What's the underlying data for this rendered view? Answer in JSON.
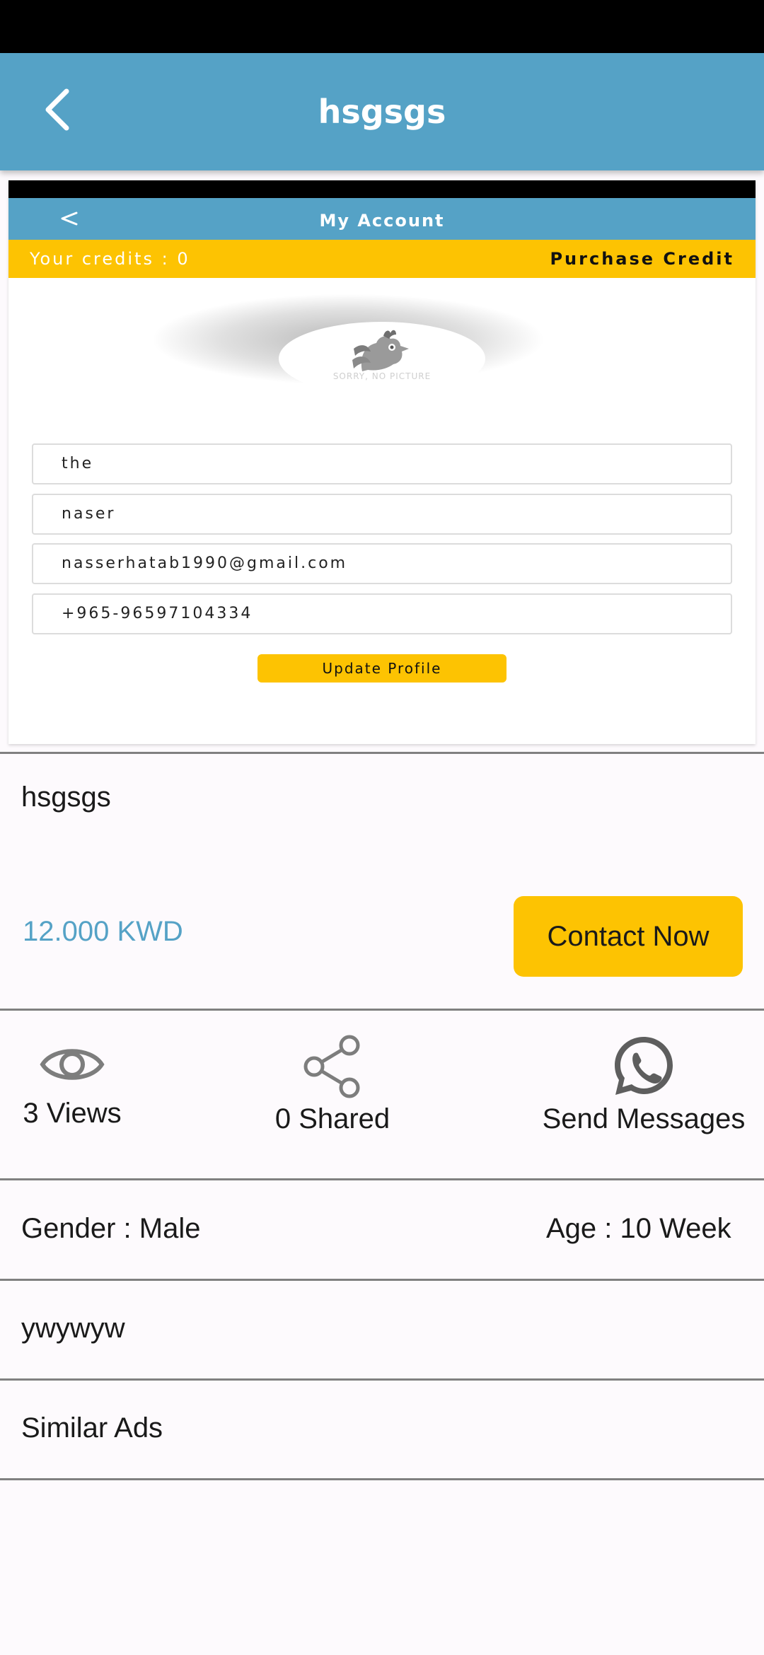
{
  "app_bar": {
    "title": "hsgsgs",
    "back_icon": "chevron-left-icon"
  },
  "ad_image": {
    "header_title": "My Account",
    "credits_text": "Your credits : 0",
    "purchase_text": "Purchase Credit",
    "no_picture_text": "SORRY, NO PICTURE",
    "fields": [
      "the",
      "naser",
      "nasserhatab1990@gmail.com",
      "+965-96597104334"
    ],
    "update_button": "Update Profile"
  },
  "ad": {
    "title": "hsgsgs",
    "price": "12.000 KWD",
    "contact_button": "Contact Now"
  },
  "stats": {
    "views": {
      "icon": "eye-icon",
      "label": "3 Views"
    },
    "shared": {
      "icon": "share-icon",
      "label": "0 Shared"
    },
    "messages": {
      "icon": "whatsapp-icon",
      "label": "Send Messages"
    }
  },
  "details": {
    "gender": "Gender : Male",
    "age": "Age : 10 Week",
    "description": "ywywyw",
    "similar_ads": "Similar Ads"
  },
  "colors": {
    "primary": "#55a2c6",
    "accent": "#fdc302",
    "background": "#fdfafd",
    "divider": "#808080"
  }
}
